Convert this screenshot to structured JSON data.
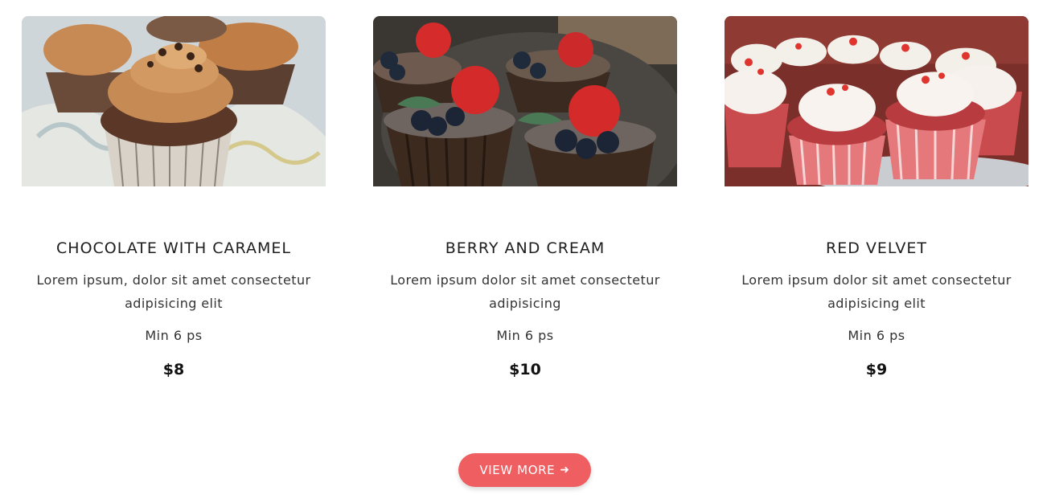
{
  "products": [
    {
      "title": "CHOCOLATE WITH CARAMEL",
      "description": "Lorem ipsum, dolor sit amet consectetur adipisicing elit",
      "min_order": "Min 6 ps",
      "price": "$8"
    },
    {
      "title": "BERRY AND CREAM",
      "description": "Lorem ipsum dolor sit amet consectetur adipisicing",
      "min_order": "Min 6 ps",
      "price": "$10"
    },
    {
      "title": "RED VELVET",
      "description": "Lorem ipsum dolor sit amet consectetur adipisicing elit",
      "min_order": "Min 6 ps",
      "price": "$9"
    }
  ],
  "view_more": {
    "label": "VIEW MORE",
    "icon": "arrow-right-icon"
  },
  "colors": {
    "button": "#ef5f62",
    "text": "#222222"
  }
}
